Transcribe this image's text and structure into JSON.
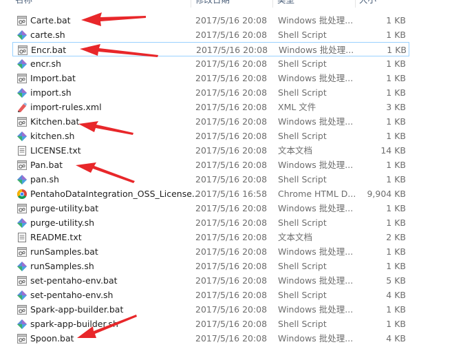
{
  "header": {
    "name": "名称",
    "date": "修改日期",
    "type": "类型",
    "size": "大小"
  },
  "colors": {
    "arrow": "#e8272a",
    "selected_border": "#99d1ff",
    "meta_text": "#6d6d6d"
  },
  "files": [
    {
      "name": "Carte.bat",
      "date": "2017/5/16 20:08",
      "type": "Windows 批处理...",
      "size": "1 KB",
      "icon": "batch-file-icon"
    },
    {
      "name": "carte.sh",
      "date": "2017/5/16 20:08",
      "type": "Shell Script",
      "size": "1 KB",
      "icon": "shell-script-icon"
    },
    {
      "name": "Encr.bat",
      "date": "2017/5/16 20:08",
      "type": "Windows 批处理...",
      "size": "1 KB",
      "icon": "batch-file-icon",
      "selected": true
    },
    {
      "name": "encr.sh",
      "date": "2017/5/16 20:08",
      "type": "Shell Script",
      "size": "1 KB",
      "icon": "shell-script-icon"
    },
    {
      "name": "Import.bat",
      "date": "2017/5/16 20:08",
      "type": "Windows 批处理...",
      "size": "1 KB",
      "icon": "batch-file-icon"
    },
    {
      "name": "import.sh",
      "date": "2017/5/16 20:08",
      "type": "Shell Script",
      "size": "1 KB",
      "icon": "shell-script-icon"
    },
    {
      "name": "import-rules.xml",
      "date": "2017/5/16 20:08",
      "type": "XML 文件",
      "size": "3 KB",
      "icon": "xml-file-icon"
    },
    {
      "name": "Kitchen.bat",
      "date": "2017/5/16 20:08",
      "type": "Windows 批处理...",
      "size": "1 KB",
      "icon": "batch-file-icon"
    },
    {
      "name": "kitchen.sh",
      "date": "2017/5/16 20:08",
      "type": "Shell Script",
      "size": "1 KB",
      "icon": "shell-script-icon"
    },
    {
      "name": "LICENSE.txt",
      "date": "2017/5/16 20:08",
      "type": "文本文档",
      "size": "14 KB",
      "icon": "text-file-icon"
    },
    {
      "name": "Pan.bat",
      "date": "2017/5/16 20:08",
      "type": "Windows 批处理...",
      "size": "1 KB",
      "icon": "batch-file-icon"
    },
    {
      "name": "pan.sh",
      "date": "2017/5/16 20:08",
      "type": "Shell Script",
      "size": "1 KB",
      "icon": "shell-script-icon"
    },
    {
      "name": "PentahoDataIntegration_OSS_License...",
      "date": "2017/5/16 16:58",
      "type": "Chrome HTML D...",
      "size": "9,904 KB",
      "icon": "chrome-html-icon"
    },
    {
      "name": "purge-utility.bat",
      "date": "2017/5/16 20:08",
      "type": "Windows 批处理...",
      "size": "1 KB",
      "icon": "batch-file-icon"
    },
    {
      "name": "purge-utility.sh",
      "date": "2017/5/16 20:08",
      "type": "Shell Script",
      "size": "1 KB",
      "icon": "shell-script-icon"
    },
    {
      "name": "README.txt",
      "date": "2017/5/16 20:08",
      "type": "文本文档",
      "size": "2 KB",
      "icon": "text-file-icon"
    },
    {
      "name": "runSamples.bat",
      "date": "2017/5/16 20:08",
      "type": "Windows 批处理...",
      "size": "1 KB",
      "icon": "batch-file-icon"
    },
    {
      "name": "runSamples.sh",
      "date": "2017/5/16 20:08",
      "type": "Shell Script",
      "size": "1 KB",
      "icon": "shell-script-icon"
    },
    {
      "name": "set-pentaho-env.bat",
      "date": "2017/5/16 20:08",
      "type": "Windows 批处理...",
      "size": "5 KB",
      "icon": "batch-file-icon"
    },
    {
      "name": "set-pentaho-env.sh",
      "date": "2017/5/16 20:08",
      "type": "Shell Script",
      "size": "4 KB",
      "icon": "shell-script-icon"
    },
    {
      "name": "Spark-app-builder.bat",
      "date": "2017/5/16 20:08",
      "type": "Windows 批处理...",
      "size": "1 KB",
      "icon": "batch-file-icon"
    },
    {
      "name": "spark-app-builder.sh",
      "date": "2017/5/16 20:08",
      "type": "Shell Script",
      "size": "1 KB",
      "icon": "shell-script-icon"
    },
    {
      "name": "Spoon.bat",
      "date": "2017/5/16 20:08",
      "type": "Windows 批处理...",
      "size": "4 KB",
      "icon": "batch-file-icon"
    }
  ]
}
